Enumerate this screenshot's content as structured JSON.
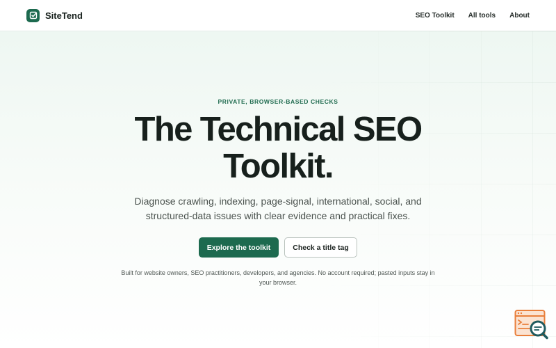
{
  "header": {
    "brand_name": "SiteTend",
    "logo_icon": "checkmark-square-icon",
    "nav": [
      {
        "label": "SEO Toolkit"
      },
      {
        "label": "All tools"
      },
      {
        "label": "About"
      }
    ]
  },
  "hero": {
    "eyebrow": "PRIVATE, BROWSER-BASED CHECKS",
    "title_line1": "The Technical SEO",
    "title_line2": "Toolkit.",
    "subtitle_line1": "Diagnose crawling, indexing, page-signal, international, social, and",
    "subtitle_line2": "structured-data issues with clear evidence and practical fixes.",
    "primary_button": "Explore the toolkit",
    "secondary_button": "Check a title tag",
    "note_line1": "Built for website owners, SEO practitioners, developers, and agencies. No account required; pasted inputs stay in",
    "note_line2": "your browser."
  },
  "widget": {
    "icon": "browser-search-icon"
  },
  "colors": {
    "accent": "#1d6a4f",
    "widget_orange": "#e97f3c",
    "widget_teal": "#1f5a5e"
  }
}
